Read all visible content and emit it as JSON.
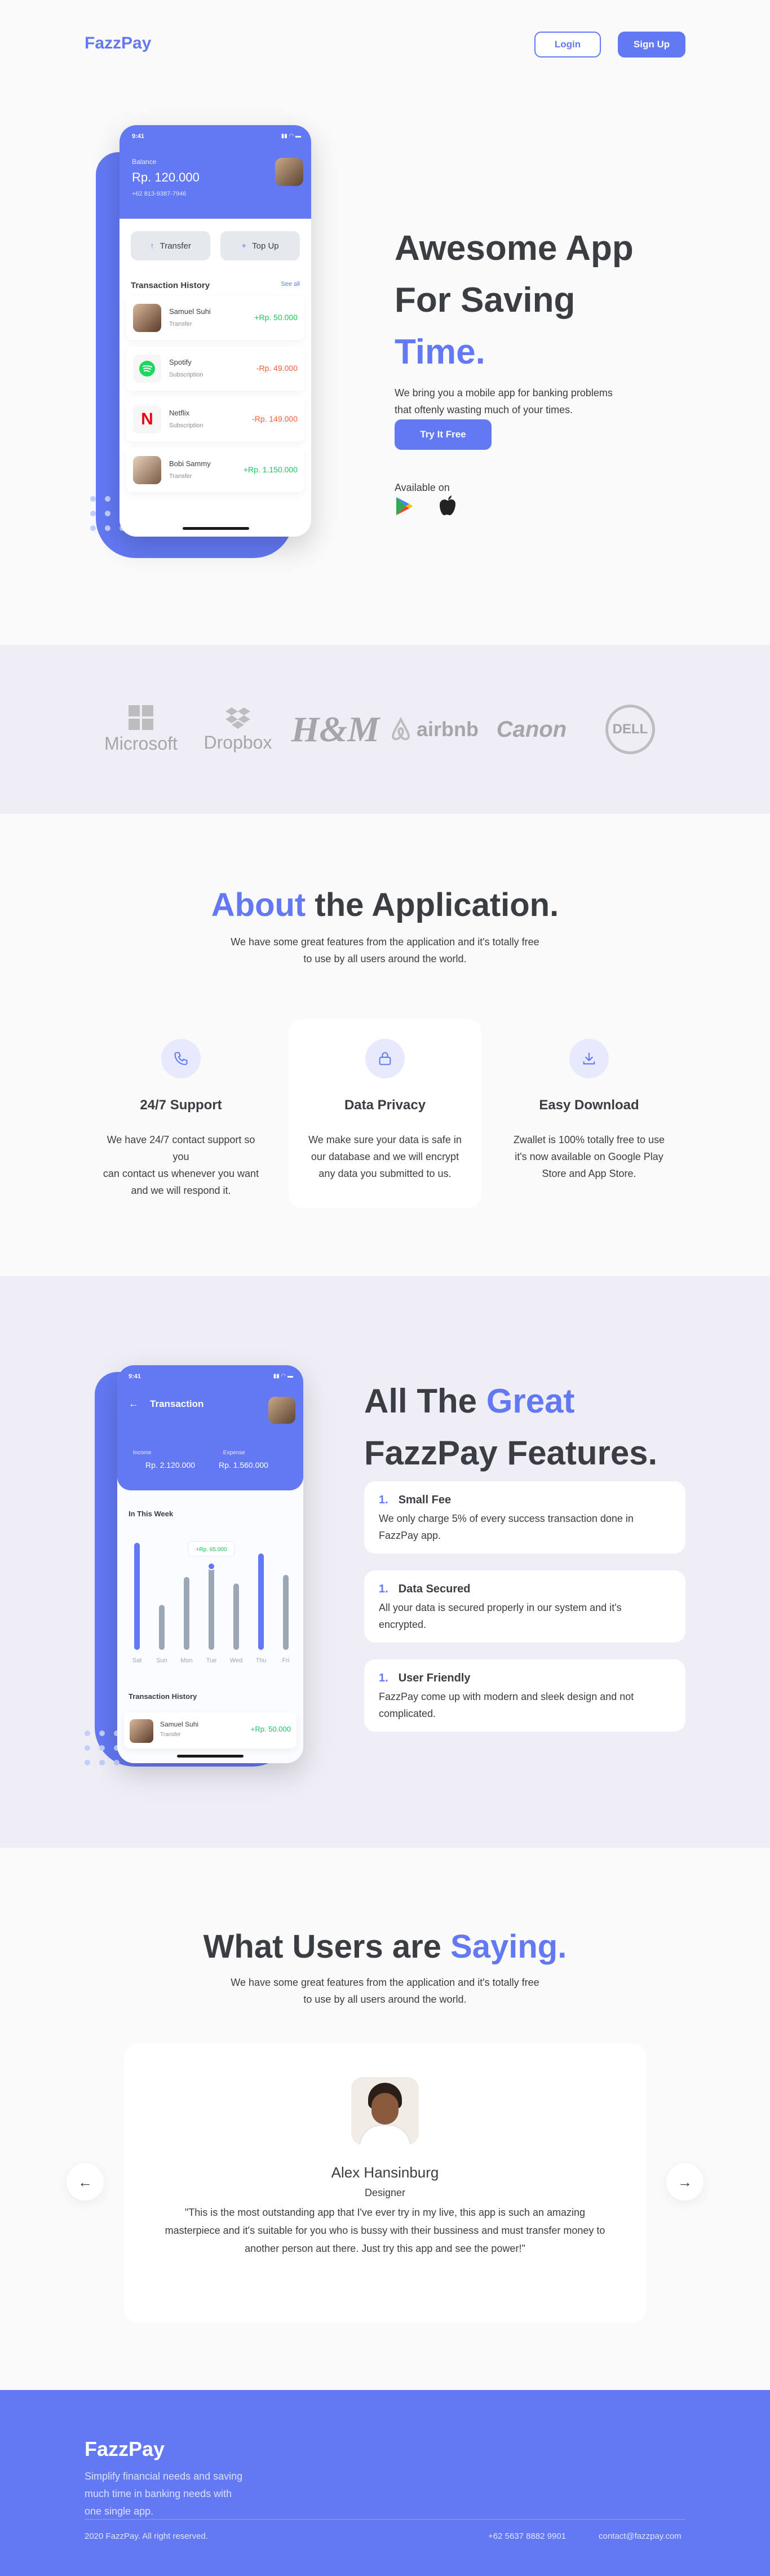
{
  "nav": {
    "logo": "FazzPay",
    "login": "Login",
    "signup": "Sign Up"
  },
  "hero": {
    "title_line1": "Awesome App",
    "title_line2": "For Saving",
    "title_accent": "Time.",
    "description": "We bring you a mobile app for banking problems that oftenly wasting much of your times.",
    "cta": "Try It Free",
    "available_on": "Available on"
  },
  "phone1": {
    "time": "9:41",
    "balance_label": "Balance",
    "balance": "Rp. 120.000",
    "phone_number": "+62 813-9387-7946",
    "transfer": "Transfer",
    "topup": "Top Up",
    "history_title": "Transaction History",
    "see_all": "See all",
    "transactions": [
      {
        "name": "Samuel Suhi",
        "type": "Transfer",
        "amount": "+Rp. 50.000",
        "positive": true,
        "icon": "avatar"
      },
      {
        "name": "Spotify",
        "type": "Subscription",
        "amount": "-Rp. 49.000",
        "positive": false,
        "icon": "spotify-icon"
      },
      {
        "name": "Netflix",
        "type": "Subscription",
        "amount": "-Rp. 149.000",
        "positive": false,
        "icon": "netflix-icon"
      },
      {
        "name": "Bobi Sammy",
        "type": "Transfer",
        "amount": "+Rp. 1.150.000",
        "positive": true,
        "icon": "avatar"
      }
    ]
  },
  "partners": [
    "Microsoft",
    "Dropbox",
    "H&M",
    "airbnb",
    "Canon",
    "DELL"
  ],
  "about": {
    "title_accent": "About",
    "title_rest": "the Application.",
    "subtitle_line1": "We have some great features from the application and it's totally free",
    "subtitle_line2": "to use by all users around the world.",
    "cards": [
      {
        "icon": "phone-icon",
        "title": "24/7 Support",
        "desc": [
          "We have 24/7 contact support so",
          "you",
          "can contact us whenever you want",
          "and we will respond it."
        ]
      },
      {
        "icon": "lock-icon",
        "title": "Data Privacy",
        "desc": [
          "We make sure your data is safe in",
          "our database and we will encrypt",
          "any data you submitted to us."
        ]
      },
      {
        "icon": "download-icon",
        "title": "Easy Download",
        "desc": [
          "Zwallet is 100% totally free to use",
          "it's now available on Google Play",
          "Store and App Store."
        ]
      }
    ]
  },
  "phone2": {
    "time": "9:41",
    "header": "Transaction",
    "income_label": "Income",
    "income": "Rp. 2.120.000",
    "expense_label": "Expense",
    "expense": "Rp. 1.560.000",
    "week_label": "In This Week",
    "tooltip": "+Rp. 65.000",
    "history_title": "Transaction History",
    "transaction": {
      "name": "Samuel Suhi",
      "type": "Transfer",
      "amount": "+Rp. 50.000"
    }
  },
  "chart_data": {
    "type": "bar",
    "categories": [
      "Sat",
      "Sun",
      "Mon",
      "Tue",
      "Wed",
      "Thu",
      "Fri"
    ],
    "values": [
      100,
      42,
      68,
      78,
      62,
      90,
      70
    ],
    "highlight": "Tue"
  },
  "features": {
    "title_line1": "All The",
    "title_accent": "Great",
    "title_line2": "FazzPay Features.",
    "items": [
      {
        "num": "1.",
        "title": "Small Fee",
        "desc": "We only charge 5% of every success transaction done in FazzPay app."
      },
      {
        "num": "1.",
        "title": "Data Secured",
        "desc": "All your data is secured properly in our system and it's encrypted."
      },
      {
        "num": "1.",
        "title": "User Friendly",
        "desc": "FazzPay come up with modern and sleek design and not complicated."
      }
    ]
  },
  "testimonials": {
    "title_rest": "What Users are",
    "title_accent": "Saying.",
    "subtitle_line1": "We have some great features from the application and it's totally free",
    "subtitle_line2": "to use by all users around the world.",
    "name": "Alex Hansinburg",
    "role": "Designer",
    "quote_line1": "\"This is the most outstanding app that I've ever try in my live, this app is such an amazing",
    "quote_line2": "masterpiece and it's suitable for you who is bussy with their bussiness and must transfer money to",
    "quote_line3": "another person aut there. Just try this app and see the power!\""
  },
  "footer": {
    "logo": "FazzPay",
    "tagline_line1": "Simplify financial needs and saving",
    "tagline_line2": "much time in banking needs with",
    "tagline_line3": "one single app.",
    "copyright": "2020 FazzPay. All right reserved.",
    "phone": "+62 5637 8882 9901",
    "email": "contact@fazzpay.com"
  },
  "colors": {
    "accent": "#6379f4",
    "positive": "#1ec15f",
    "negative": "#ff5b37"
  }
}
